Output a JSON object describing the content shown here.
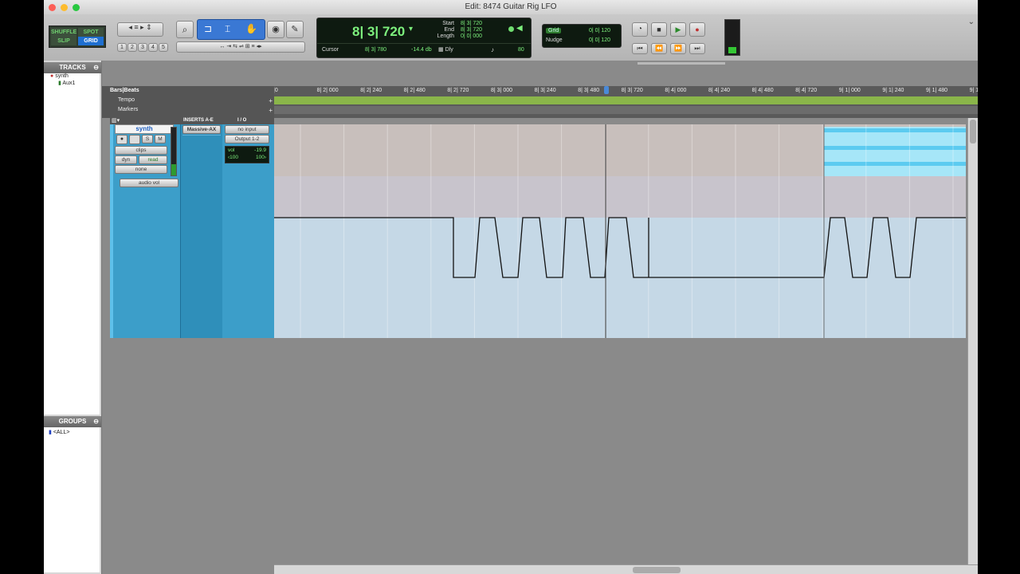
{
  "window": {
    "title": "Edit: 8474 Guitar Rig LFO"
  },
  "toolbar": {
    "modes": {
      "shuffle": "SHUFFLE",
      "spot": "SPOT",
      "slip": "SLIP",
      "grid": "GRID"
    },
    "zoom_presets": [
      "1",
      "2",
      "3",
      "4",
      "5"
    ],
    "counter": {
      "main": "8| 3| 720",
      "start_label": "Start",
      "end_label": "End",
      "length_label": "Length",
      "start": "8| 3| 720",
      "end": "8| 3| 720",
      "length": "0| 0| 000",
      "cursor_label": "Cursor",
      "cursor": "8| 3| 780",
      "cursor_db": "-14.4 db",
      "dly_label": "Dly",
      "tempo": "80"
    },
    "grid": {
      "grid_label": "Grid",
      "grid_value": "0| 0| 120",
      "nudge_label": "Nudge",
      "nudge_value": "0| 0| 120"
    }
  },
  "sidebar": {
    "tracks_header": "TRACKS",
    "tracks": [
      "synth",
      "Aux1"
    ],
    "groups_header": "GROUPS",
    "groups": [
      "<ALL>"
    ]
  },
  "rulers": {
    "bars_beats": "Bars|Beats",
    "tempo": "Tempo",
    "markers": "Markers",
    "ticks": [
      "|0",
      "8| 2| 000",
      "8| 2| 240",
      "8| 2| 480",
      "8| 2| 720",
      "8| 3| 000",
      "8| 3| 240",
      "8| 3| 480",
      "8| 3| 720",
      "8| 4| 000",
      "8| 4| 240",
      "8| 4| 480",
      "8| 4| 720",
      "9| 1| 000",
      "9| 1| 240",
      "9| 1| 480",
      "9| 1|"
    ]
  },
  "track": {
    "name": "synth",
    "rec": "",
    "solo": "S",
    "mute": "M",
    "view": "clips",
    "dyn": "dyn",
    "automation": "read",
    "none": "none",
    "audio_vol": "audio vol",
    "inserts_header": "INSERTS A-E",
    "io_header": "I / O",
    "insert_1": "Massive-AX",
    "input": "no input",
    "output": "Output 1-2",
    "vol_label": "vol",
    "vol_value": "-19.9",
    "pan_left": "‹100",
    "pan_right": "100›"
  },
  "colors": {
    "track_color": "#3c9ec9",
    "clip_color": "#a6e6f8",
    "counter_bg": "#0e1a10",
    "counter_text": "#7df07d"
  }
}
